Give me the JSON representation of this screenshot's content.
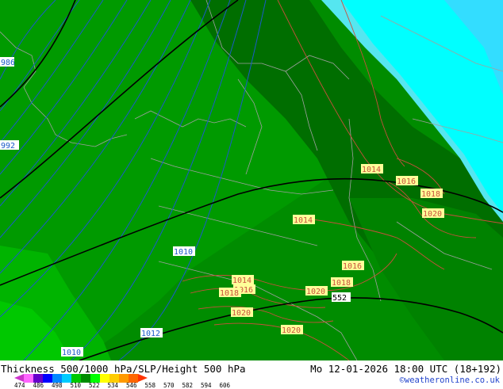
{
  "map": {
    "isobar_labels_blue": [
      "986",
      "992",
      "1010",
      "1012",
      "1010"
    ],
    "isobar_labels_red": [
      "1014",
      "1016",
      "1018",
      "1020",
      "1014",
      "1016",
      "1018",
      "1014",
      "1016",
      "1018",
      "1020",
      "1020",
      "1020"
    ],
    "height_label": "552",
    "colors": {
      "thickness_534": "#008c00",
      "thickness_540_dark": "#006e00",
      "thickness_528": "#00a000",
      "thickness_522": "#00c800",
      "cold_cyan": "#00ffff",
      "cold_light": "#55e6f0",
      "isobar_blue": "#1a5ac8",
      "isobar_red": "#c8503c",
      "height_contour": "#000000",
      "border_line": "#9a9a9a",
      "label_bg": "#ffff99"
    }
  },
  "footer": {
    "title": "Thickness 500/1000 hPa/SLP/Height 500 hPa",
    "datetime": "Mo 12-01-2026 18:00 UTC (18+192)",
    "credit": "©weatheronline.co.uk",
    "colorbar_ticks": [
      "474",
      "486",
      "498",
      "510",
      "522",
      "534",
      "546",
      "558",
      "570",
      "582",
      "594",
      "606"
    ],
    "colorbar_colors": [
      "#cc33cc",
      "#ff66ff",
      "#6600cc",
      "#0000ff",
      "#0088ff",
      "#00ccff",
      "#00c800",
      "#008c00",
      "#00ff00",
      "#ffff00",
      "#ffcc00",
      "#ff9900",
      "#ff6600",
      "#ff3300"
    ]
  }
}
